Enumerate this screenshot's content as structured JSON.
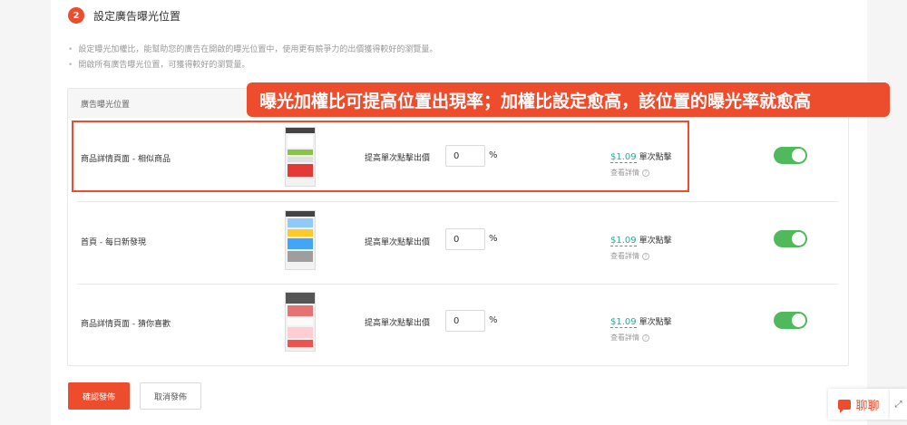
{
  "section": {
    "step_number": "2",
    "title": "設定廣告曝光位置"
  },
  "notes": [
    "設定曝光加權比，能幫助您的廣告在開啟的曝光位置中，使用更有競爭力的出價獲得較好的瀏覽量。",
    "開啟所有廣告曝光位置，可獲得較好的瀏覽量。"
  ],
  "table": {
    "header": "廣告曝光位置",
    "rows": [
      {
        "label": "商品詳情頁面 - 相似商品",
        "bid_label": "提高單次點擊出價",
        "bid_value": "0",
        "pct": "%",
        "price": "$1.09",
        "price_unit": "單次點擊",
        "details": "查看詳情",
        "enabled": true
      },
      {
        "label": "首頁 - 每日新發現",
        "bid_label": "提高單次點擊出價",
        "bid_value": "0",
        "pct": "%",
        "price": "$1.09",
        "price_unit": "單次點擊",
        "details": "查看詳情",
        "enabled": true
      },
      {
        "label": "商品詳情頁面 - 猜你喜歡",
        "bid_label": "提高單次點擊出價",
        "bid_value": "0",
        "pct": "%",
        "price": "$1.09",
        "price_unit": "單次點擊",
        "details": "查看詳情",
        "enabled": true
      }
    ]
  },
  "callout": "曝光加權比可提高位置出現率；加權比設定愈高，該位置的曝光率就愈高",
  "buttons": {
    "confirm": "確認發佈",
    "cancel": "取消發佈"
  },
  "chat": {
    "label": "聊聊",
    "icon": "chat-bubble-icon"
  },
  "colors": {
    "accent": "#ee4d2d",
    "toggle_on": "#50b95c",
    "price": "#26aa99"
  }
}
